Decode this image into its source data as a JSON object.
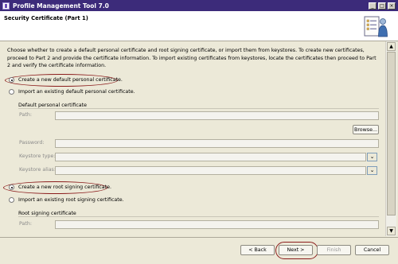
{
  "window": {
    "title": "Profile Management Tool 7.0",
    "minimize": "_",
    "maximize": "□",
    "close": "×"
  },
  "header": {
    "title": "Security Certificate (Part 1)"
  },
  "intro": "Choose whether to create a default personal certificate and root signing certificate, or import them from keystores. To create new certificates, proceed to Part 2 and provide the certificate information. To import existing certificates from keystores, locate the certificates then proceed to Part 2 and verify the certificate information.",
  "personal": {
    "create_label": "Create a new default personal certificate.",
    "create_selected": true,
    "import_label": "Import an existing default personal certificate.",
    "group_title": "Default personal certificate",
    "path_label": "Path:",
    "browse_label": "Browse...",
    "password_label": "Password:",
    "keystore_type_label": "Keystore type:",
    "keystore_alias_label": "Keystore alias:"
  },
  "root": {
    "create_label": "Create a new root signing certificate.",
    "create_selected": true,
    "import_label": "Import an existing root signing certificate.",
    "group_title": "Root signing certificate",
    "path_label": "Path:"
  },
  "footer": {
    "back": "< Back",
    "next": "Next >",
    "finish": "Finish",
    "cancel": "Cancel"
  },
  "colors": {
    "titlebar": "#3c2b7a",
    "highlight_ring": "#8b1c1c",
    "dialog_bg": "#ece9d8"
  }
}
